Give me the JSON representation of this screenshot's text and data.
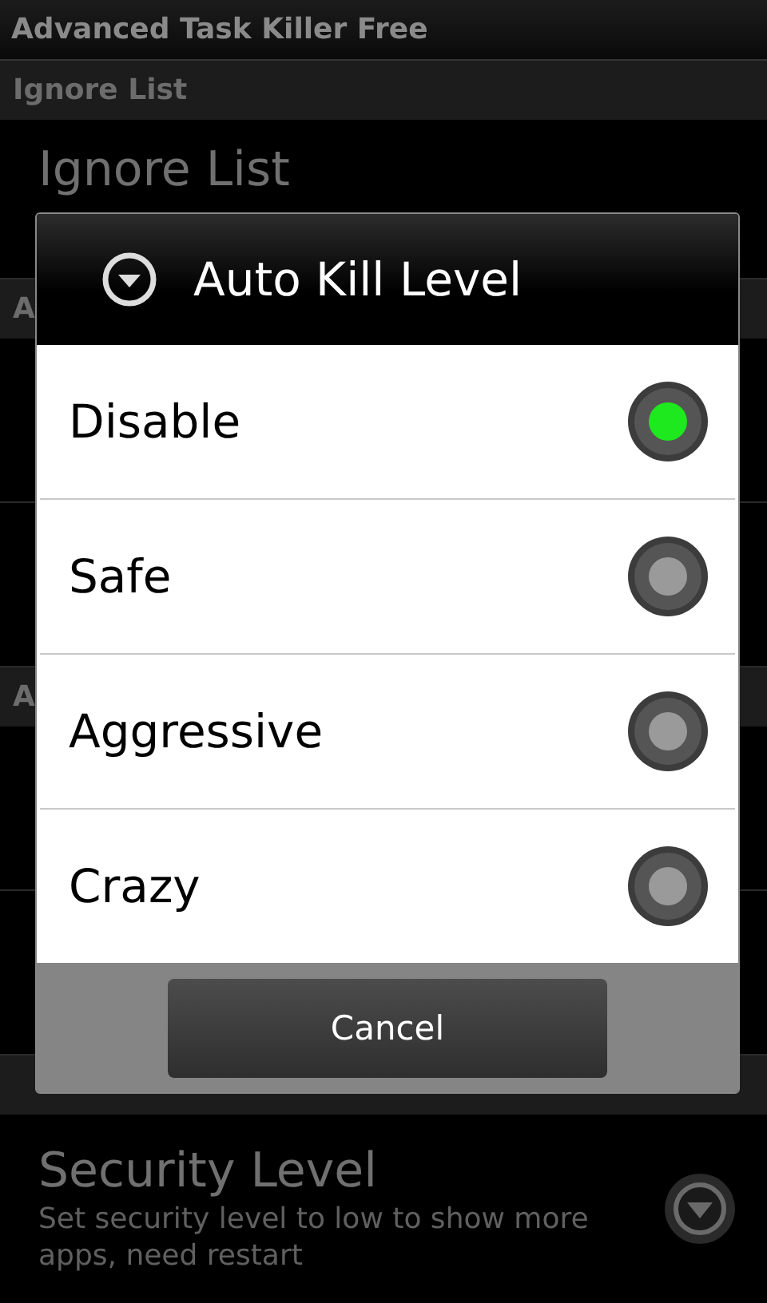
{
  "window": {
    "title": "Advanced Task Killer Free"
  },
  "background": {
    "sections": [
      {
        "header": "Ignore List",
        "items": [
          {
            "title": "Ignore List"
          }
        ]
      },
      {
        "header": "A",
        "items": [
          {
            "kind": "blank"
          },
          {
            "kind": "blank"
          }
        ]
      },
      {
        "header": "A",
        "items": [
          {
            "kind": "blank"
          },
          {
            "kind": "blank"
          }
        ]
      },
      {
        "items": [
          {
            "title": "Security Level",
            "summary": "Set security level to low to show more apps, need restart",
            "dropdown": true
          }
        ]
      }
    ]
  },
  "dialog": {
    "title": "Auto Kill Level",
    "options": [
      {
        "label": "Disable",
        "selected": true
      },
      {
        "label": "Safe",
        "selected": false
      },
      {
        "label": "Aggressive",
        "selected": false
      },
      {
        "label": "Crazy",
        "selected": false
      }
    ],
    "buttons": [
      "Cancel"
    ]
  }
}
